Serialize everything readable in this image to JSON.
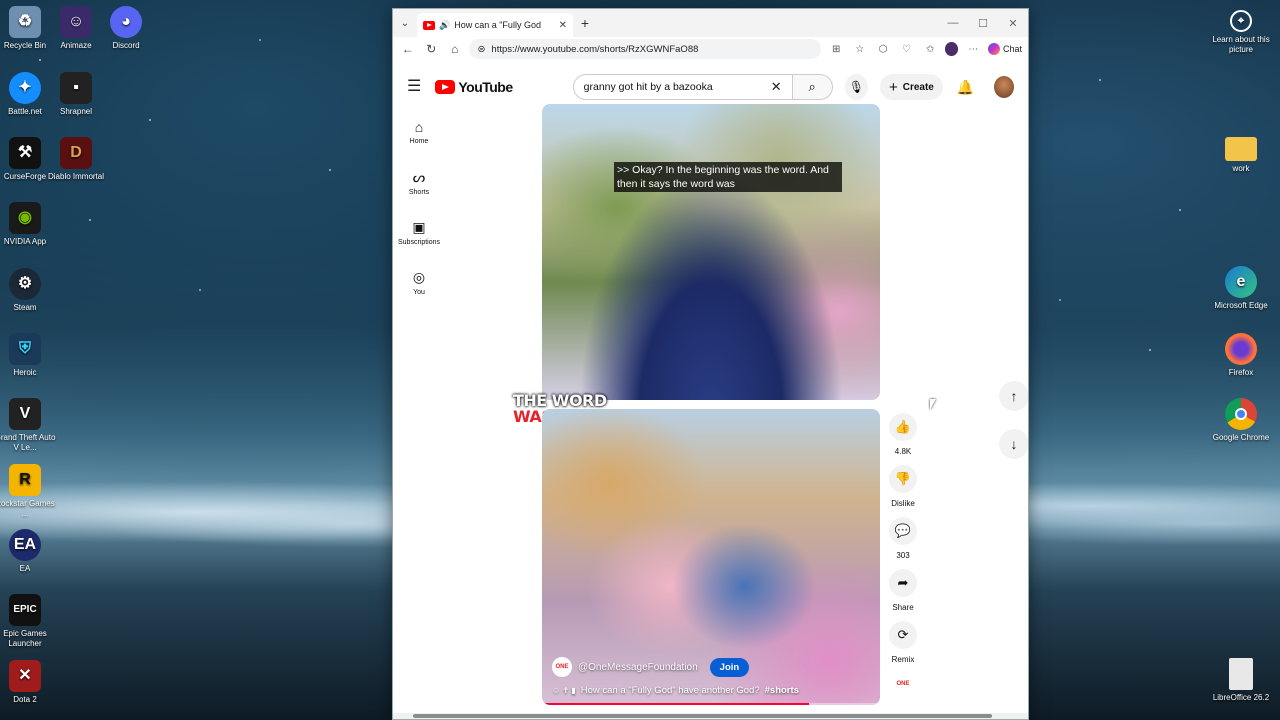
{
  "desktop": {
    "left_icons": [
      {
        "label": "Recycle Bin",
        "icon": "recycle-bin-icon",
        "color": "#6f8fb0"
      },
      {
        "label": "Animaze",
        "icon": "animaze-icon",
        "color": "#3a2a6a"
      },
      {
        "label": "Discord",
        "icon": "discord-icon",
        "color": "#5865f2"
      },
      {
        "label": "Battle.net",
        "icon": "battlenet-icon",
        "color": "#148eff"
      },
      {
        "label": "Shrapnel",
        "icon": "shrapnel-icon",
        "color": "#222222"
      },
      {
        "label": "CurseForge",
        "icon": "curseforge-icon",
        "color": "#111111"
      },
      {
        "label": "Diablo Immortal",
        "icon": "diablo-icon",
        "color": "#5a1010"
      },
      {
        "label": "NVIDIA App",
        "icon": "nvidia-icon",
        "color": "#1a1a1a"
      },
      {
        "label": "Steam",
        "icon": "steam-icon",
        "color": "#1b2838"
      },
      {
        "label": "Heroic",
        "icon": "heroic-icon",
        "color": "#1b3a5a"
      },
      {
        "label": "Grand Theft Auto V Le...",
        "icon": "gta-icon",
        "color": "#222222"
      },
      {
        "label": "Rockstar Games ...",
        "icon": "rockstar-icon",
        "color": "#f4b400"
      },
      {
        "label": "EA",
        "icon": "ea-icon",
        "color": "#1b2a6a"
      },
      {
        "label": "Epic Games Launcher",
        "icon": "epic-icon",
        "color": "#111111"
      },
      {
        "label": "Dota 2",
        "icon": "dota-icon",
        "color": "#a01c1c"
      }
    ],
    "right_icons": [
      {
        "label": "Learn about this picture",
        "icon": "learn-picture-icon",
        "color": "#ffffff"
      },
      {
        "label": "work",
        "icon": "folder-icon",
        "color": "#f3c44a"
      },
      {
        "label": "Microsoft Edge",
        "icon": "edge-icon",
        "color": "#1a7ad1"
      },
      {
        "label": "Firefox",
        "icon": "firefox-icon",
        "color": "#ff7139"
      },
      {
        "label": "Google Chrome",
        "icon": "chrome-icon",
        "color": "#db4437"
      },
      {
        "label": "LibreOffice 26.2",
        "icon": "libreoffice-icon",
        "color": "#e8e8e8"
      }
    ]
  },
  "browser": {
    "tab_title": "How can a \"Fully God",
    "url": "https://www.youtube.com/shorts/RzXGWNFaO88",
    "chat_label": "Chat"
  },
  "youtube": {
    "logo_text": "YouTube",
    "search_value": "granny got hit by a bazooka",
    "create_label": "Create",
    "guide": [
      {
        "label": "Home",
        "icon": "home-icon"
      },
      {
        "label": "Shorts",
        "icon": "shorts-icon"
      },
      {
        "label": "Subscriptions",
        "icon": "subscriptions-icon"
      },
      {
        "label": "You",
        "icon": "you-icon"
      }
    ],
    "short": {
      "caption": ">> Okay? In the beginning was the word. And then it says the word was",
      "overlay_line1": "THE WORD",
      "overlay_line2": "WAS GOD",
      "channel": "@OneMessageFoundation",
      "channel_badge": "ONE",
      "join_label": "Join",
      "title": "How can a \"Fully God\" have another  God?",
      "hashtag": "#shorts",
      "progress": 0.79
    },
    "actions": [
      {
        "label": "4.8K",
        "icon": "like-icon"
      },
      {
        "label": "Dislike",
        "icon": "dislike-icon"
      },
      {
        "label": "303",
        "icon": "comment-icon"
      },
      {
        "label": "Share",
        "icon": "share-icon"
      },
      {
        "label": "Remix",
        "icon": "remix-icon"
      }
    ],
    "brand_chip": "ONE"
  }
}
